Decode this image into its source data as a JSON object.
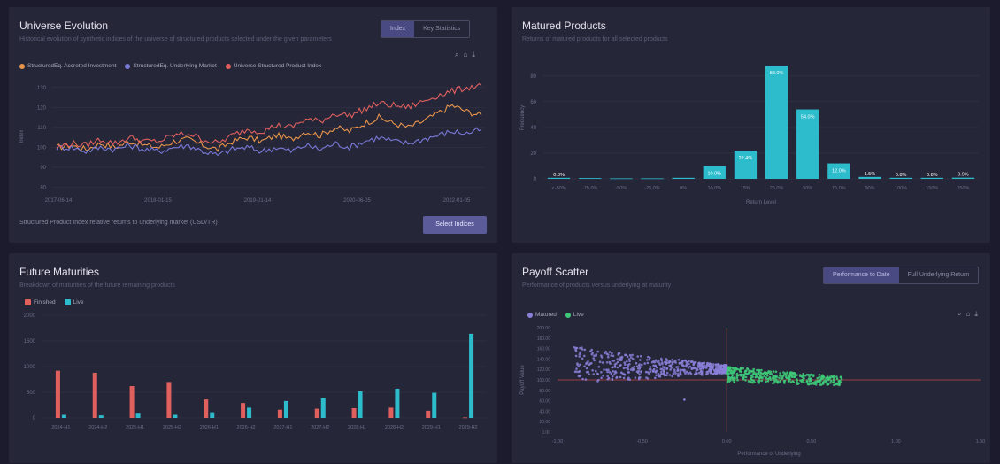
{
  "colors": {
    "orange": "#e8954a",
    "purple": "#7878d8",
    "red": "#e0605e",
    "teal": "#2cbccc",
    "green": "#3ec878",
    "scatter_purple": "#8a80d8",
    "grid": "#34344a"
  },
  "universe": {
    "title": "Universe Evolution",
    "subtitle": "Historical evolution of synthetic indices of the universe of structured products selected under the given parameters",
    "tabs": [
      "Index",
      "Key Statistics"
    ],
    "active_tab": "Index",
    "tools": [
      "zoom-icon",
      "home-icon",
      "download-icon"
    ],
    "note": "Structured Product Index relative returns to underlying market (USD/TR)",
    "button": "Select Indices",
    "chart_data": {
      "type": "line",
      "title": "",
      "xlabel": "",
      "ylabel": "Index",
      "x_ticks": [
        "2017-06-14",
        "2018-01-15",
        "2019-01-14",
        "2020-06-05",
        "2022-01-05"
      ],
      "y_ticks": [
        80,
        90,
        100,
        110,
        120,
        130
      ],
      "ylim": [
        78,
        133
      ],
      "series": [
        {
          "name": "StructuredEq. Accreted Investment",
          "color": "#e8954a",
          "values": [
            100,
            101,
            99,
            102,
            100,
            103,
            101,
            100,
            103,
            104,
            101,
            99,
            103,
            105,
            103,
            106,
            104,
            108,
            106,
            110,
            108,
            112,
            115,
            112,
            110,
            113,
            117,
            121,
            118,
            116
          ]
        },
        {
          "name": "StructuredEq. Underlying Market",
          "color": "#7878d8",
          "values": [
            100,
            100,
            98,
            100,
            99,
            101,
            99,
            98,
            100,
            101,
            98,
            96,
            99,
            100,
            98,
            100,
            98,
            101,
            99,
            102,
            100,
            103,
            105,
            103,
            102,
            104,
            106,
            108,
            107,
            109
          ]
        },
        {
          "name": "Universe Structured Product Index",
          "color": "#e0605e",
          "values": [
            100,
            102,
            101,
            104,
            102,
            105,
            103,
            103,
            106,
            107,
            104,
            102,
            106,
            109,
            108,
            111,
            110,
            114,
            113,
            117,
            116,
            119,
            122,
            121,
            120,
            123,
            126,
            128,
            130,
            131
          ]
        }
      ]
    }
  },
  "matured": {
    "title": "Matured Products",
    "subtitle": "Returns of matured products for all selected products",
    "chart_data": {
      "type": "bar",
      "title": "",
      "xlabel": "Return Level",
      "ylabel": "Frequency",
      "categories": [
        "<-50%",
        "-75.0%",
        "-50%",
        "-25.0%",
        "0%",
        "10.0%",
        "15%",
        "25.0%",
        "50%",
        "75.0%",
        "90%",
        "100%",
        "150%",
        "250%"
      ],
      "values": [
        0.8,
        0.6,
        0.4,
        0.4,
        0.8,
        10,
        22,
        88,
        54,
        12,
        1.5,
        0.8,
        0.8,
        0.9
      ],
      "labels": [
        "0.8%",
        "",
        "",
        "",
        "",
        "10.0%",
        "22.4%",
        "88.0%",
        "54.0%",
        "12.0%",
        "1.5%",
        "0.8%",
        "0.8%",
        "0.9%"
      ],
      "y_ticks": [
        0,
        20,
        40,
        60,
        80
      ],
      "ylim": [
        0,
        95
      ],
      "color": "#2cbccc"
    }
  },
  "maturities": {
    "title": "Future Maturities",
    "subtitle": "Breakdown of maturities of the future remaining products",
    "chart_data": {
      "type": "bar",
      "title": "",
      "xlabel": "",
      "ylabel": "",
      "categories": [
        "2024-H1",
        "2024-H2",
        "2025-H1",
        "2025-H2",
        "2026-H1",
        "2026-H2",
        "2027-H1",
        "2027-H2",
        "2028-H1",
        "2028-H2",
        "2029-H1",
        "2029-H2"
      ],
      "series": [
        {
          "name": "Finished",
          "color": "#e0605e",
          "values": [
            920,
            880,
            620,
            700,
            360,
            290,
            160,
            180,
            190,
            200,
            140,
            10
          ]
        },
        {
          "name": "Live",
          "color": "#2cbccc",
          "values": [
            60,
            50,
            100,
            60,
            110,
            200,
            330,
            380,
            520,
            570,
            490,
            1640
          ]
        }
      ],
      "y_ticks": [
        0,
        500,
        1000,
        1500,
        2000
      ],
      "ylim": [
        0,
        2000
      ]
    }
  },
  "payoff": {
    "title": "Payoff Scatter",
    "subtitle": "Performance of products versus underlying at maturity",
    "tabs": [
      "Performance to Date",
      "Full Underlying Return"
    ],
    "active_tab": "Performance to Date",
    "tools": [
      "zoom-icon",
      "home-icon",
      "download-icon"
    ],
    "chart_data": {
      "type": "scatter",
      "title": "",
      "xlabel": "Performance of Underlying",
      "ylabel": "Payoff Value",
      "x_ticks": [
        "-1.00",
        "-0.50",
        "0.00",
        "0.50",
        "1.00",
        "1.50"
      ],
      "y_ticks": [
        "200.00",
        "180.00",
        "160.00",
        "140.00",
        "120.00",
        "100.00",
        "80.00",
        "60.00",
        "40.00",
        "20.00",
        "0.00"
      ],
      "xlim": [
        -1,
        1.5
      ],
      "ylim": [
        0,
        200
      ],
      "series": [
        {
          "name": "Matured",
          "color": "#8a80d8"
        },
        {
          "name": "Live",
          "color": "#3ec878"
        }
      ],
      "reference_x": 0,
      "reference_y": 100
    }
  }
}
